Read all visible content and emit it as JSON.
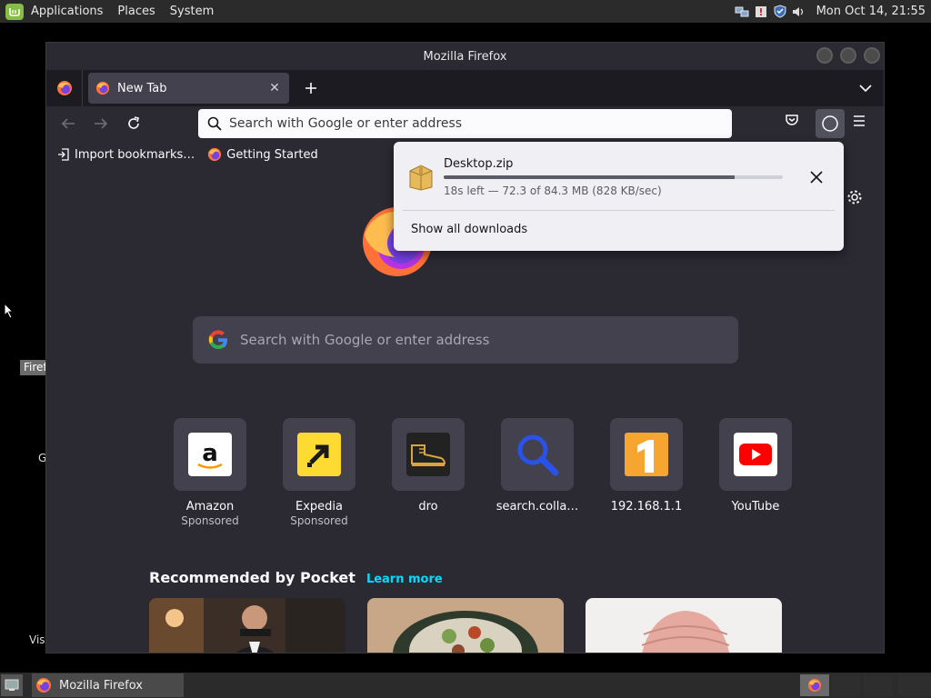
{
  "top_panel": {
    "menus": [
      "Applications",
      "Places",
      "System"
    ],
    "clock": "Mon Oct 14, 21:55"
  },
  "desktop": {
    "frag_fire": "Firef",
    "frag_g": "G",
    "frag_vis": "Vis"
  },
  "window": {
    "title": "Mozilla Firefox"
  },
  "tabs": [
    {
      "label": "New Tab"
    }
  ],
  "navbar": {
    "url_placeholder": "Search with Google or enter address"
  },
  "bookmarks": [
    {
      "label": "Import bookmarks…"
    },
    {
      "label": "Getting Started"
    }
  ],
  "newtab": {
    "search_placeholder": "Search with Google or enter address",
    "top_sites": [
      {
        "title": "Amazon",
        "sponsored": "Sponsored"
      },
      {
        "title": "Expedia",
        "sponsored": "Sponsored"
      },
      {
        "title": "dro",
        "sponsored": ""
      },
      {
        "title": "search.colla…",
        "sponsored": ""
      },
      {
        "title": "192.168.1.1",
        "sponsored": ""
      },
      {
        "title": "YouTube",
        "sponsored": ""
      }
    ],
    "pocket_title": "Recommended by Pocket",
    "pocket_learn_more": "Learn more"
  },
  "downloads": {
    "file_name": "Desktop.zip",
    "status": "18s left — 72.3 of 84.3 MB (828 KB/sec)",
    "progress_fraction": 0.858,
    "show_all_label": "Show all downloads"
  },
  "taskbar": {
    "firefox_label": "Mozilla Firefox"
  },
  "colors": {
    "accent_cyan": "#00ddff",
    "toolbar": "#2b2a33",
    "tab_active": "#42414d"
  }
}
